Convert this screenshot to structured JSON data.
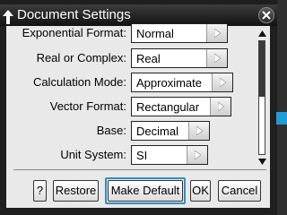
{
  "dialog": {
    "title": "Document Settings",
    "settings": [
      {
        "label": "Exponential Format:",
        "value": "Normal"
      },
      {
        "label": "Real or Complex:",
        "value": "Real"
      },
      {
        "label": "Calculation Mode:",
        "value": "Approximate"
      },
      {
        "label": "Vector Format:",
        "value": "Rectangular"
      },
      {
        "label": "Base:",
        "value": "Decimal"
      },
      {
        "label": "Unit System:",
        "value": "SI"
      }
    ],
    "buttons": {
      "help": "?",
      "restore": "Restore",
      "make_default": "Make Default",
      "ok": "OK",
      "cancel": "Cancel"
    },
    "focused_button": "make_default"
  },
  "icons": {
    "title_arrow": "up-arrow-icon",
    "close": "close-icon",
    "dropdown": "chevron-right-icon",
    "scroll_up": "scroll-up-arrow-icon",
    "scroll_down": "scroll-down-arrow-icon"
  },
  "colors": {
    "focus": "#2f8fc4",
    "accent": "#1f9bd6",
    "panel": "#e9e9e9",
    "titlebar": "#1a1a1a"
  }
}
